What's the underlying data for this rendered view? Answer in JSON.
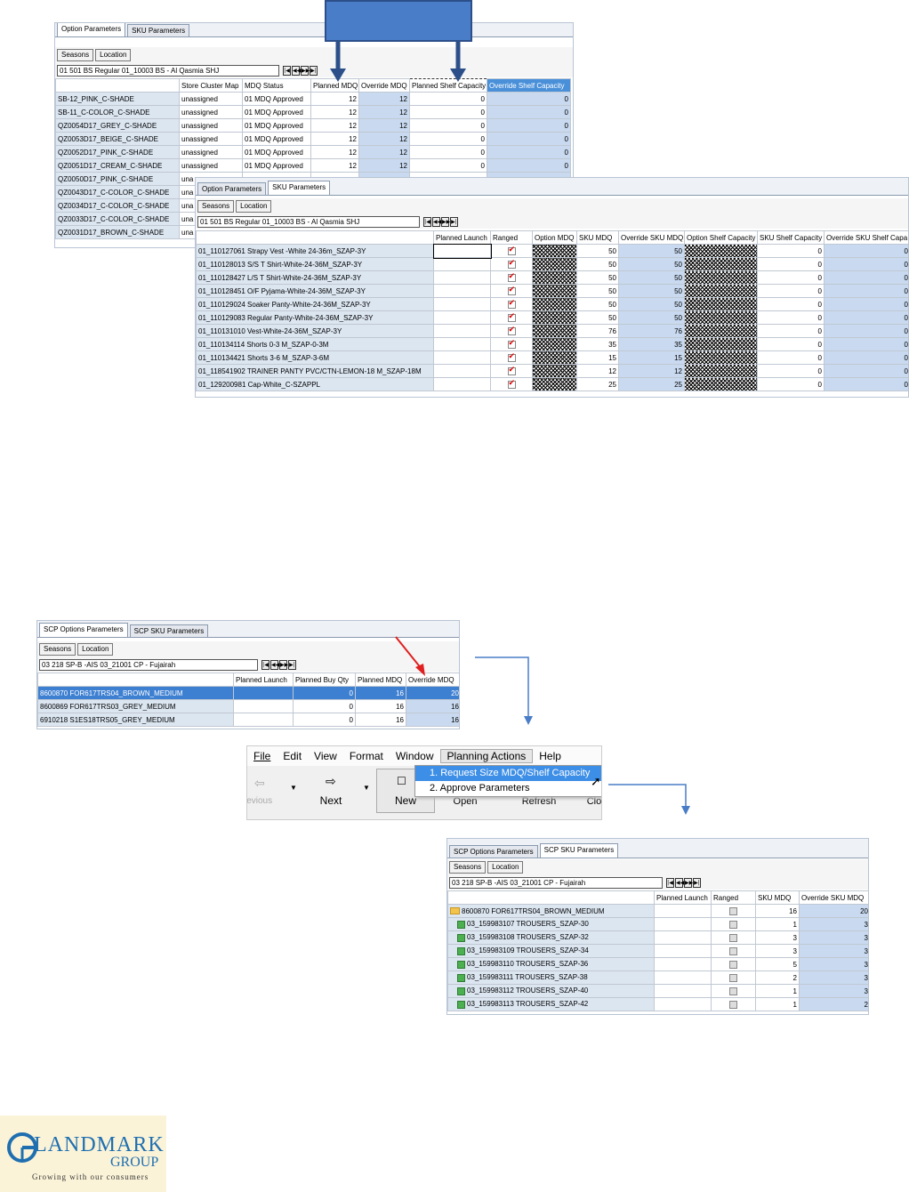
{
  "p1": {
    "tabs": [
      "Option Parameters",
      "SKU Parameters"
    ],
    "buttons": [
      "Seasons",
      "Location"
    ],
    "selector": "01  501  BS Regular  01_10003 BS - Al Qasmia SHJ",
    "headers": [
      "Store Cluster Map",
      "MDQ Status",
      "Planned MDQ",
      "Override MDQ",
      "Planned Shelf Capacity",
      "Override Shelf Capacity"
    ],
    "rows": [
      {
        "label": "SB-12_PINK_C-SHADE",
        "cluster": "unassigned",
        "status": "01 MDQ Approved",
        "pmdq": "12",
        "omdq": "12",
        "psc": "0",
        "osc": "0"
      },
      {
        "label": "SB-11_C-COLOR_C-SHADE",
        "cluster": "unassigned",
        "status": "01 MDQ Approved",
        "pmdq": "12",
        "omdq": "12",
        "psc": "0",
        "osc": "0"
      },
      {
        "label": "QZ0054D17_GREY_C-SHADE",
        "cluster": "unassigned",
        "status": "01 MDQ Approved",
        "pmdq": "12",
        "omdq": "12",
        "psc": "0",
        "osc": "0"
      },
      {
        "label": "QZ0053D17_BEIGE_C-SHADE",
        "cluster": "unassigned",
        "status": "01 MDQ Approved",
        "pmdq": "12",
        "omdq": "12",
        "psc": "0",
        "osc": "0"
      },
      {
        "label": "QZ0052D17_PINK_C-SHADE",
        "cluster": "unassigned",
        "status": "01 MDQ Approved",
        "pmdq": "12",
        "omdq": "12",
        "psc": "0",
        "osc": "0"
      },
      {
        "label": "QZ0051D17_CREAM_C-SHADE",
        "cluster": "unassigned",
        "status": "01 MDQ Approved",
        "pmdq": "12",
        "omdq": "12",
        "psc": "0",
        "osc": "0"
      },
      {
        "label": "QZ0050D17_PINK_C-SHADE",
        "cluster": "una",
        "status": "",
        "pmdq": "",
        "omdq": "",
        "psc": "",
        "osc": ""
      },
      {
        "label": "QZ0043D17_C-COLOR_C-SHADE",
        "cluster": "una",
        "status": "",
        "pmdq": "",
        "omdq": "",
        "psc": "",
        "osc": ""
      },
      {
        "label": "QZ0034D17_C-COLOR_C-SHADE",
        "cluster": "una",
        "status": "",
        "pmdq": "",
        "omdq": "",
        "psc": "",
        "osc": ""
      },
      {
        "label": "QZ0033D17_C-COLOR_C-SHADE",
        "cluster": "una",
        "status": "",
        "pmdq": "",
        "omdq": "",
        "psc": "",
        "osc": ""
      },
      {
        "label": "QZ0031D17_BROWN_C-SHADE",
        "cluster": "una",
        "status": "",
        "pmdq": "",
        "omdq": "",
        "psc": "",
        "osc": ""
      }
    ]
  },
  "p2": {
    "tabs": [
      "Option Parameters",
      "SKU Parameters"
    ],
    "buttons": [
      "Seasons",
      "Location"
    ],
    "selector": "01  501  BS Regular  01_10003 BS - Al Qasmia SHJ",
    "headers": [
      "Planned Launch",
      "Ranged",
      "Option MDQ",
      "SKU MDQ",
      "Override SKU MDQ",
      "Option Shelf Capacity",
      "SKU Shelf Capacity",
      "Override SKU Shelf Capa"
    ],
    "rows": [
      {
        "label": "01_110127061 Strapy Vest -White 24-36m_SZAP-3Y",
        "sku": "50",
        "osku": "50",
        "ssc": "0",
        "ossc": "0"
      },
      {
        "label": "01_110128013 S/S T Shirt-White-24-36M_SZAP-3Y",
        "sku": "50",
        "osku": "50",
        "ssc": "0",
        "ossc": "0"
      },
      {
        "label": "01_110128427 L/S T Shirt-White-24-36M_SZAP-3Y",
        "sku": "50",
        "osku": "50",
        "ssc": "0",
        "ossc": "0"
      },
      {
        "label": "01_110128451 O/F Pyjama-White-24-36M_SZAP-3Y",
        "sku": "50",
        "osku": "50",
        "ssc": "0",
        "ossc": "0"
      },
      {
        "label": "01_110129024 Soaker Panty-White-24-36M_SZAP-3Y",
        "sku": "50",
        "osku": "50",
        "ssc": "0",
        "ossc": "0"
      },
      {
        "label": "01_110129083 Regular Panty-White-24-36M_SZAP-3Y",
        "sku": "50",
        "osku": "50",
        "ssc": "0",
        "ossc": "0"
      },
      {
        "label": "01_110131010 Vest-White-24-36M_SZAP-3Y",
        "sku": "76",
        "osku": "76",
        "ssc": "0",
        "ossc": "0"
      },
      {
        "label": "01_110134114 Shorts 0-3 M_SZAP-0-3M",
        "sku": "35",
        "osku": "35",
        "ssc": "0",
        "ossc": "0"
      },
      {
        "label": "01_110134421 Shorts 3-6 M_SZAP-3-6M",
        "sku": "15",
        "osku": "15",
        "ssc": "0",
        "ossc": "0"
      },
      {
        "label": "01_118541902 TRAINER PANTY PVC/CTN-LEMON-18 M_SZAP-18M",
        "sku": "12",
        "osku": "12",
        "ssc": "0",
        "ossc": "0"
      },
      {
        "label": "01_129200981 Cap-White_C-SZAPPL",
        "sku": "25",
        "osku": "25",
        "ssc": "0",
        "ossc": "0"
      }
    ]
  },
  "p3": {
    "tabs": [
      "SCP Options Parameters",
      "SCP SKU Parameters"
    ],
    "buttons": [
      "Seasons",
      "Location"
    ],
    "selector": "03  218  SP-B -AIS  03_21001 CP - Fujairah",
    "headers": [
      "Planned Launch",
      "Planned Buy Qty",
      "Planned MDQ",
      "Override MDQ"
    ],
    "rows": [
      {
        "label": "8600870 FOR617TRS04_BROWN_MEDIUM",
        "buy": "0",
        "pmdq": "16",
        "omdq": "20"
      },
      {
        "label": "8600869 FOR617TRS03_GREY_MEDIUM",
        "buy": "0",
        "pmdq": "16",
        "omdq": "16"
      },
      {
        "label": "6910218 S1ES18TRS05_GREY_MEDIUM",
        "buy": "0",
        "pmdq": "16",
        "omdq": "16"
      }
    ]
  },
  "menu": {
    "items": [
      "File",
      "Edit",
      "View",
      "Format",
      "Window",
      "Planning Actions",
      "Help"
    ],
    "dropdown": [
      "1. Request Size MDQ/Shelf Capacity",
      "2. Approve Parameters"
    ],
    "toolbar": [
      "revious",
      "Next",
      "New",
      "Open",
      "Refresh",
      "Clo"
    ]
  },
  "p4": {
    "tabs": [
      "SCP Options Parameters",
      "SCP SKU Parameters"
    ],
    "buttons": [
      "Seasons",
      "Location"
    ],
    "selector": "03  218  SP-B -AIS  03_21001 CP - Fujairah",
    "headers": [
      "Planned Launch",
      "Ranged",
      "SKU MDQ",
      "Override SKU MDQ"
    ],
    "rows": [
      {
        "label": "8600870 FOR617TRS04_BROWN_MEDIUM",
        "sku": "16",
        "osku": "20"
      },
      {
        "label": "03_159983107 TROUSERS_SZAP-30",
        "sku": "1",
        "osku": "3"
      },
      {
        "label": "03_159983108 TROUSERS_SZAP-32",
        "sku": "3",
        "osku": "3"
      },
      {
        "label": "03_159983109 TROUSERS_SZAP-34",
        "sku": "3",
        "osku": "3"
      },
      {
        "label": "03_159983110 TROUSERS_SZAP-36",
        "sku": "5",
        "osku": "3"
      },
      {
        "label": "03_159983111 TROUSERS_SZAP-38",
        "sku": "2",
        "osku": "3"
      },
      {
        "label": "03_159983112 TROUSERS_SZAP-40",
        "sku": "1",
        "osku": "3"
      },
      {
        "label": "03_159983113 TROUSERS_SZAP-42",
        "sku": "1",
        "osku": "2"
      }
    ]
  },
  "logo": {
    "name": "LANDMARK",
    "group": "GROUP",
    "tagline": "Growing with our consumers"
  },
  "colors": {
    "accent": "#4a7dc7",
    "header_highlight": "#4a90d9",
    "row_select": "#3d7fd1",
    "arrow_red": "#e02020",
    "label_bg": "#dce6f1"
  }
}
